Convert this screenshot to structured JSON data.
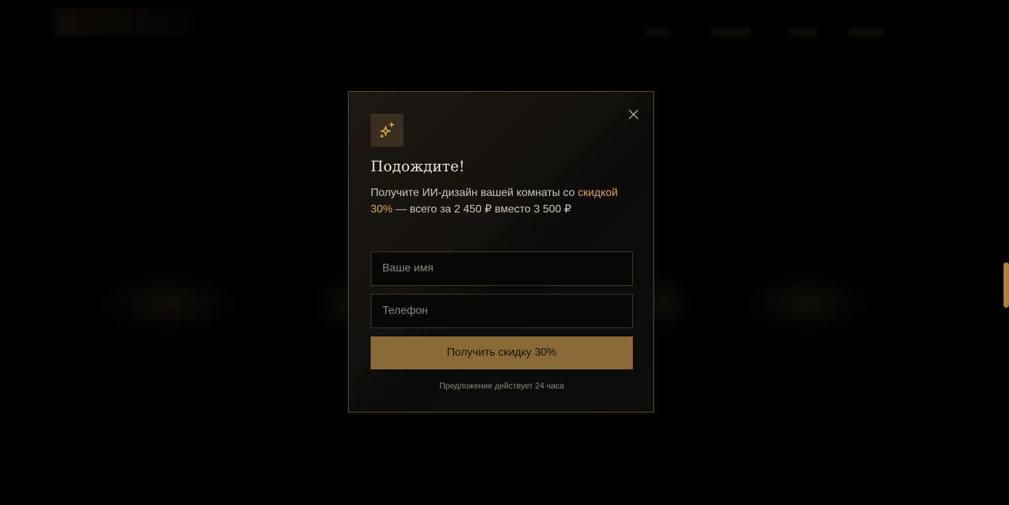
{
  "popup": {
    "title": "Подождите!",
    "description_prefix": "Получите ИИ-дизайн вашей комнаты со ",
    "description_accent": "скидкой 30%",
    "description_suffix": " — всего за 2 450 ₽ вместо 3 500 ₽",
    "name_placeholder": "Ваше имя",
    "phone_placeholder": "Телефон",
    "submit_label": "Получить скидку 30%",
    "note": "Предложение действует 24 часа",
    "icon": "sparkles-icon",
    "close_icon": "close-icon"
  },
  "colors": {
    "accent": "#dba556",
    "button": "#8a6a35",
    "border": "#6a5223",
    "scrollbar": "#b3802f"
  }
}
